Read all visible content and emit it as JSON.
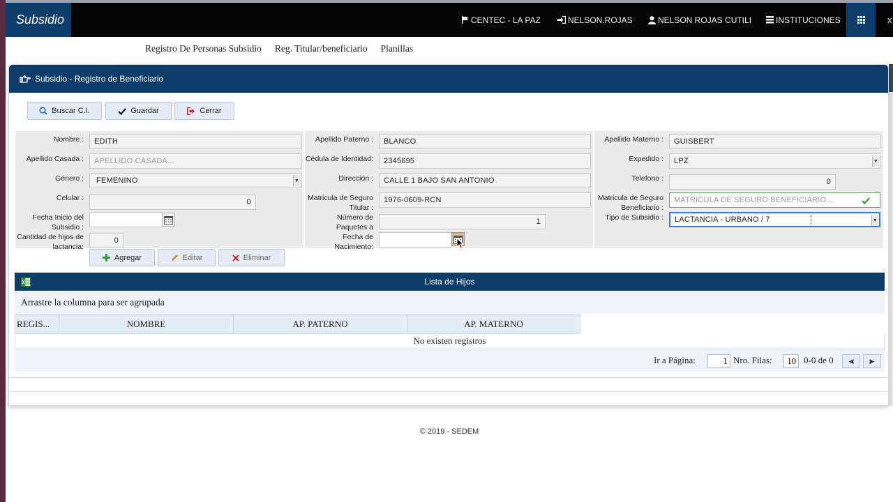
{
  "app": {
    "brand": "Subsidio"
  },
  "nav": {
    "location": "CENTEC - LA PAZ",
    "username": "NELSON.ROJAS",
    "fullname": "NELSON ROJAS CUTILI",
    "institutions": "INSTITUCIONES",
    "close": "x"
  },
  "submenu": [
    "Registro De Personas Subsidio",
    "Reg. Titular/beneficiario",
    "Planillas"
  ],
  "panel": {
    "title": "Subsidio - Registro de Beneficiario"
  },
  "toolbar": {
    "search": "Buscar C.I.",
    "save": "Guardar",
    "close": "Cerrar"
  },
  "form": {
    "nombre": {
      "label": "Nombre :",
      "value": "EDITH"
    },
    "apellido_paterno": {
      "label": "Apellido Paterno :",
      "value": "BLANCO"
    },
    "apellido_materno": {
      "label": "Apellido Materno :",
      "value": "GUISBERT"
    },
    "apellido_casada": {
      "label": "Apellido Casada :",
      "placeholder": "APELLIDO CASADA..."
    },
    "cedula": {
      "label": "Cédula de Identidad:",
      "value": "2345695"
    },
    "expedido": {
      "label": "Expedido :",
      "value": "LPZ"
    },
    "genero": {
      "label": "Género :",
      "value": "FEMENINO"
    },
    "direccion": {
      "label": "Dirección :",
      "value": "CALLE 1 BAJO SAN ANTONIO"
    },
    "telefono": {
      "label": "Telefono :",
      "value": "0"
    },
    "celular": {
      "label": "Celular :",
      "value": "0"
    },
    "matricula_titular": {
      "label": "Matricula de Seguro Titular :",
      "value": "1976-0609-RCN"
    },
    "matricula_beneficiario": {
      "label": "Matricula de Seguro Beneficiario :",
      "placeholder": "MATRICULA DE SEGURO BENEFICIARIO..."
    },
    "fecha_inicio": {
      "label": "Fecha Inicio del Subsidio :",
      "value": ""
    },
    "numero_paquetes": {
      "label": "Número de Paquetes a",
      "value": "1"
    },
    "tipo_subsidio": {
      "label": "Tipo de Subsidio :",
      "value": "LACTANCIA - URBANO / 7"
    },
    "cantidad_hijos": {
      "label": "Cantidad de hijos de lactancia:",
      "value": "0"
    },
    "fecha_nacimiento": {
      "label": "Fecha de Nacimiento:",
      "value": ""
    }
  },
  "child_actions": {
    "add": "Agregar",
    "edit": "Editar",
    "delete": "Eliminar"
  },
  "grid": {
    "title": "Lista de Hijos",
    "group_hint": "Arrastre la columna para ser agrupada",
    "columns": [
      "REGIS...",
      "NOMBRE",
      "AP. PATERNO",
      "AP. MATERNO"
    ],
    "empty": "No existen registros",
    "pager": {
      "goto_label": "Ir a Página:",
      "page": "1",
      "rows_label": "Nro. Filas:",
      "rows": "10",
      "range": "0-0 de 0"
    }
  },
  "footer": "© 2019 - SEDEM",
  "icons": [
    "flag-icon",
    "sign-in-icon",
    "user-icon",
    "list-icon",
    "grid-icon",
    "hand-point-icon",
    "search-icon",
    "check-icon",
    "sign-out-icon",
    "calendar-icon",
    "plus-icon",
    "pencil-icon",
    "times-icon",
    "excel-icon",
    "caret-left-icon",
    "caret-right-icon"
  ],
  "colors": {
    "header": "#0f3d6b",
    "navbar": "#050505",
    "form_bg": "#eaebea",
    "button_bg": "#e4edf7"
  }
}
